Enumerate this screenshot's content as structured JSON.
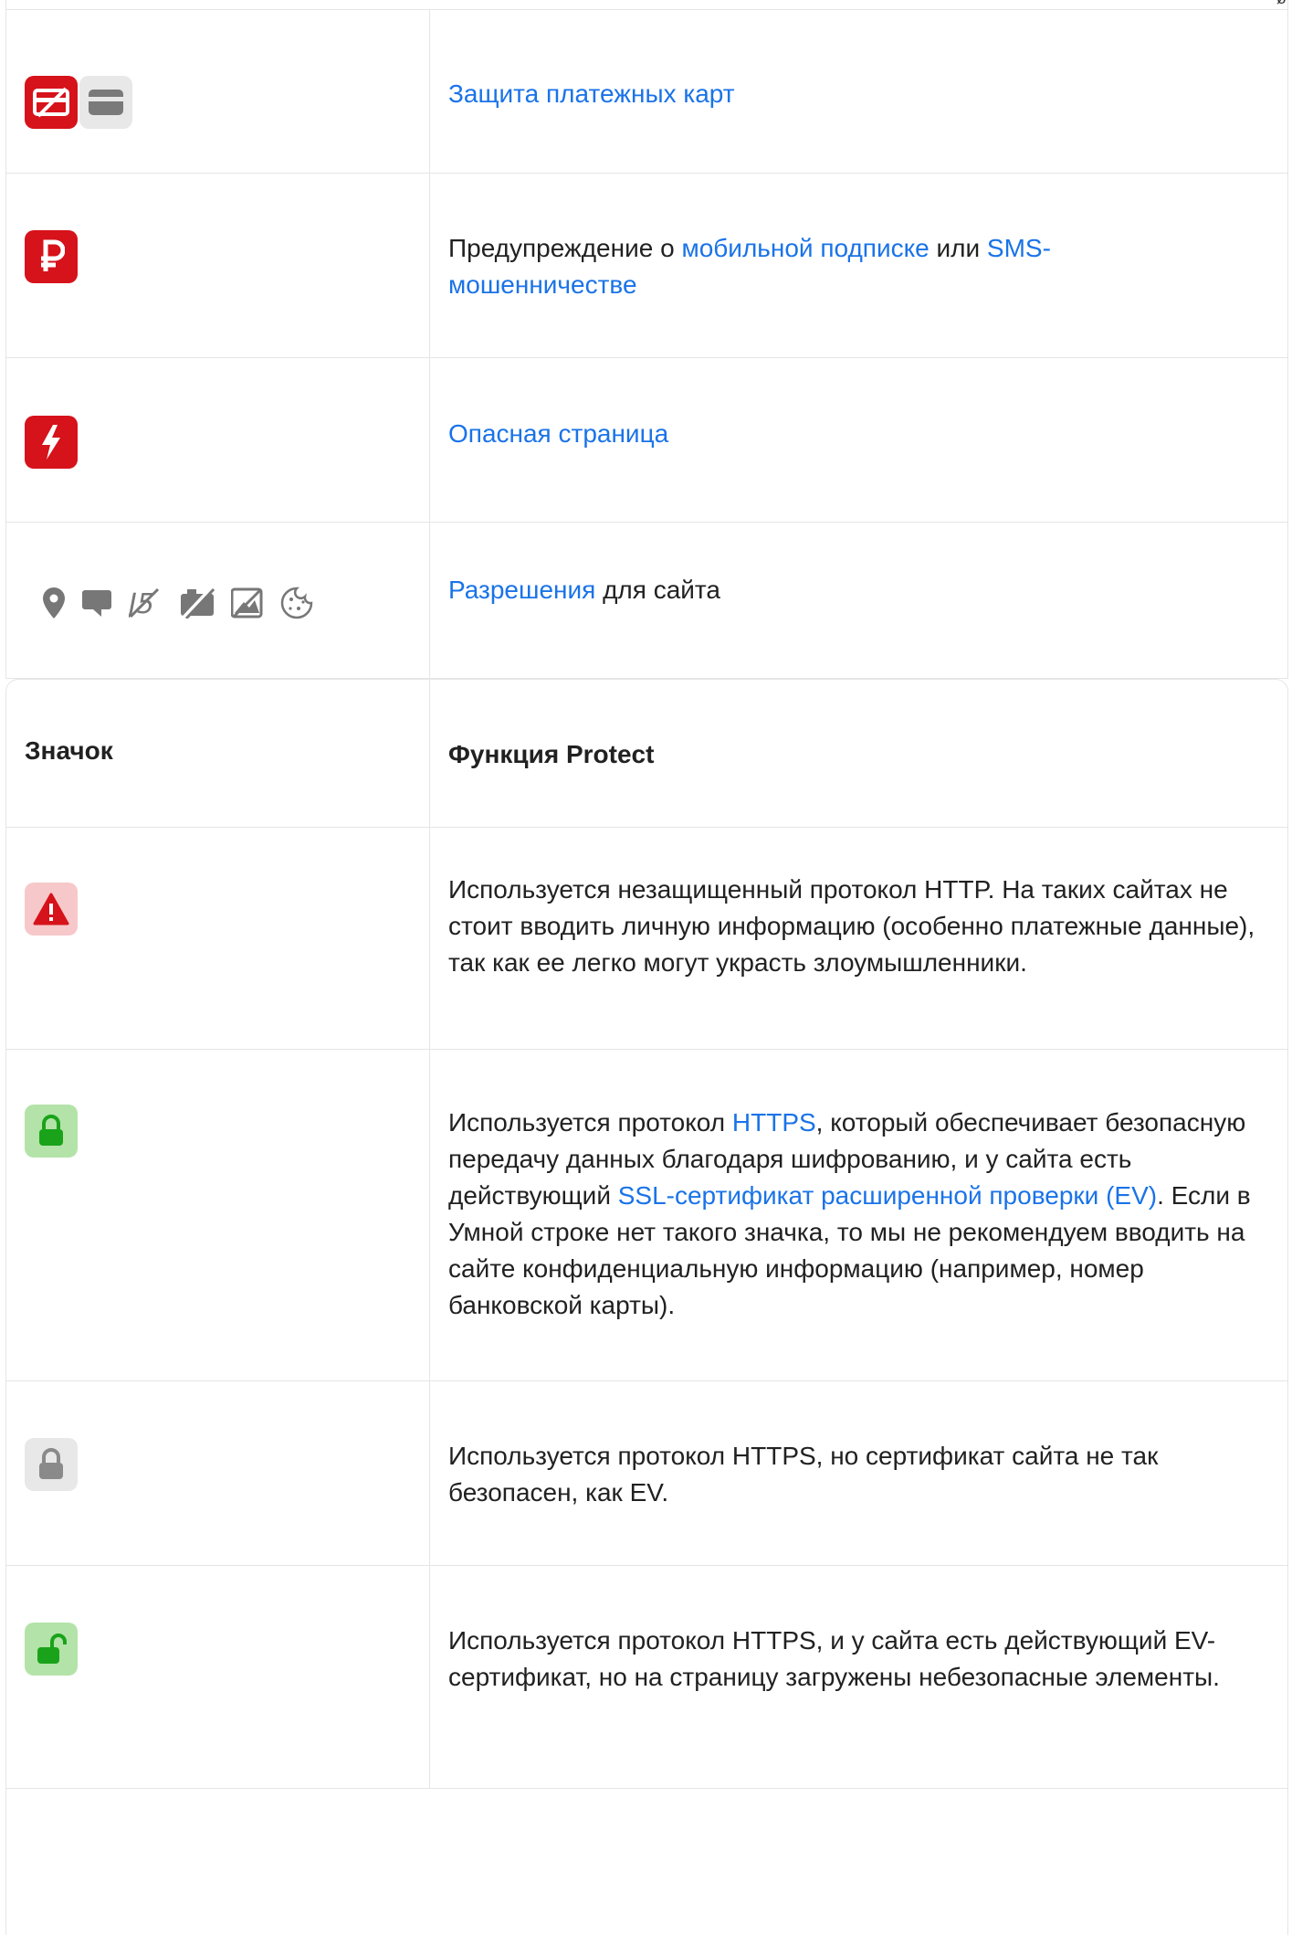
{
  "table_top": {
    "rows": [
      {
        "icon_names": [
          "card-protection-icon",
          "card-icon"
        ],
        "text_parts": [
          {
            "t": "Защита платежных карт",
            "link": true
          }
        ]
      },
      {
        "icon_names": [
          "ruble-icon"
        ],
        "text_parts": [
          {
            "t": "Предупреждение о ",
            "link": false
          },
          {
            "t": "мобильной подписке",
            "link": true
          },
          {
            "t": " или ",
            "link": false
          },
          {
            "t": "SMS-мошенничестве",
            "link": true
          }
        ]
      },
      {
        "icon_names": [
          "lightning-icon"
        ],
        "text_parts": [
          {
            "t": "Опасная страница",
            "link": true
          }
        ]
      },
      {
        "icon_names": [
          "location-icon",
          "chat-icon",
          "notifications-off-icon",
          "camera-off-icon",
          "image-off-icon",
          "cookie-icon"
        ],
        "text_parts": [
          {
            "t": "Разрешения",
            "link": true
          },
          {
            "t": " для сайта",
            "link": false
          }
        ]
      }
    ]
  },
  "table_bottom": {
    "header": {
      "col1": "Значок",
      "col2": "Функция Protect"
    },
    "rows": [
      {
        "icon": "warning-icon",
        "text_parts": [
          {
            "t": "Используется незащищенный протокол HTTP. На таких сайтах не стоит вводить личную информацию (особенно платежные данные), так как ее легко могут украсть злоумышленники.",
            "link": false
          }
        ]
      },
      {
        "icon": "lock-green-icon",
        "text_parts": [
          {
            "t": "Используется протокол ",
            "link": false
          },
          {
            "t": "HTTPS",
            "link": true
          },
          {
            "t": ", который обеспечивает безопасную передачу данных благодаря шифрованию, и у сайта есть действующий ",
            "link": false
          },
          {
            "t": "SSL-сертификат расширенной проверки (EV)",
            "link": true
          },
          {
            "t": ". Если в Умной строке нет такого значка, то мы не рекомендуем вводить на сайте конфиденциальную информацию (например, номер банковской карты).",
            "link": false
          }
        ]
      },
      {
        "icon": "lock-gray-icon",
        "text_parts": [
          {
            "t": "Используется протокол HTTPS, но сертификат сайта не так безопасен, как EV.",
            "link": false
          }
        ]
      },
      {
        "icon": "lock-open-green-icon",
        "text_parts": [
          {
            "t": "Используется протокол HTTPS, и у сайта есть действующий EV-сертификат, но на страницу загружены небезопасные элементы.",
            "link": false
          }
        ]
      }
    ]
  },
  "colors": {
    "red": "#d6121a",
    "link": "#1a73e8",
    "green": "#1aa31a",
    "gray": "#8a8a8a"
  },
  "corner_glyph": "ø"
}
